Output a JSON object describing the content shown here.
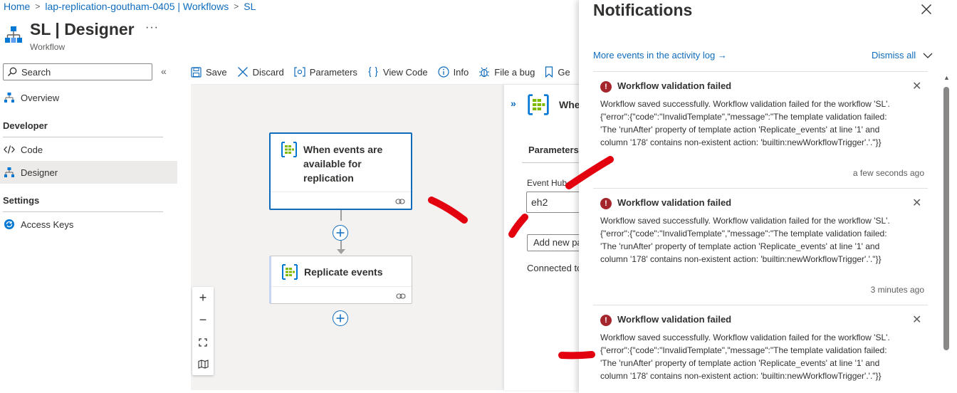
{
  "breadcrumb": [
    "Home",
    "lap-replication-goutham-0405 | Workflows",
    "SL"
  ],
  "header": {
    "title": "SL | Designer",
    "subtitle": "Workflow",
    "more": "···"
  },
  "sidebar": {
    "search_placeholder": "Search",
    "collapse": "«",
    "overview": "Overview",
    "sections": [
      {
        "header": "Developer",
        "items": [
          "Code",
          "Designer"
        ]
      },
      {
        "header": "Settings",
        "items": [
          "Access Keys"
        ]
      }
    ],
    "selected": "Designer"
  },
  "toolbar": {
    "save": "Save",
    "discard": "Discard",
    "parameters": "Parameters",
    "view_code": "View Code",
    "info": "Info",
    "file_bug": "File a bug",
    "get": "Ge"
  },
  "canvas": {
    "trigger_title_lines": [
      "When events are",
      "available for",
      "replication"
    ],
    "action_title": "Replicate events",
    "zoom_in": "+",
    "zoom_out": "−"
  },
  "detail_panel": {
    "title": "Whe",
    "tab": "Parameters",
    "event_hub_label": "Event Hub",
    "event_hub_value": "eh2",
    "add_new": "Add new pa",
    "connected": "Connected to"
  },
  "notifications": {
    "title": "Notifications",
    "activity_link": "More events in the activity log →",
    "dismiss_all": "Dismiss all",
    "items": [
      {
        "title": "Workflow validation failed",
        "body_lines": [
          "Workflow saved successfully. Workflow validation failed for the workflow 'SL'.",
          "{\"error\":{\"code\":\"InvalidTemplate\",\"message\":\"The template validation failed:",
          "'The 'runAfter' property of template action 'Replicate_events' at line '1' and",
          "column '178' contains non-existent action: 'builtin:newWorkflowTrigger'.'.\"}}"
        ],
        "time": "a few seconds ago"
      },
      {
        "title": "Workflow validation failed",
        "body_lines": [
          "Workflow saved successfully. Workflow validation failed for the workflow 'SL'.",
          "{\"error\":{\"code\":\"InvalidTemplate\",\"message\":\"The template validation failed:",
          "'The 'runAfter' property of template action 'Replicate_events' at line '1' and",
          "column '178' contains non-existent action: 'builtin:newWorkflowTrigger'.'.\"}}"
        ],
        "time": "3 minutes ago"
      },
      {
        "title": "Workflow validation failed",
        "body_lines": [
          "Workflow saved successfully. Workflow validation failed for the workflow 'SL'.",
          "{\"error\":{\"code\":\"InvalidTemplate\",\"message\":\"The template validation failed:",
          "'The 'runAfter' property of template action 'Replicate_events' at line '1' and",
          "column '178' contains non-existent action: 'builtin:newWorkflowTrigger'.'.\"}}"
        ],
        "time": ""
      }
    ]
  },
  "colors": {
    "accent": "#0f6cbd",
    "error": "#a4262c",
    "annotation": "#e3000f",
    "canvas_bg": "#f3f2f1"
  }
}
